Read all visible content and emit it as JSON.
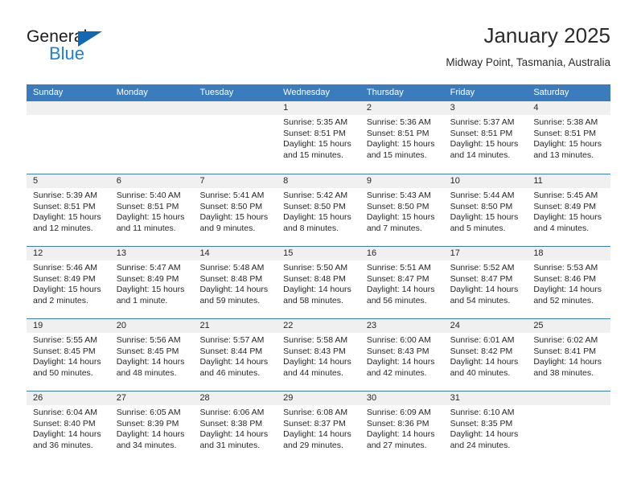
{
  "brand": {
    "name_part1": "General",
    "name_part2": "Blue",
    "triangle_color": "#1268b3",
    "blue_color": "#1f7fd0"
  },
  "header": {
    "title": "January 2025",
    "subtitle": "Midway Point, Tasmania, Australia"
  },
  "theme": {
    "header_row_bg": "#3a7cbd",
    "day_number_strip_bg": "#f0f0f0",
    "cell_bg": "#ffffff",
    "text_color": "#262626"
  },
  "calendar": {
    "weekday_headers": [
      "Sunday",
      "Monday",
      "Tuesday",
      "Wednesday",
      "Thursday",
      "Friday",
      "Saturday"
    ],
    "weeks": [
      [
        {
          "day": "",
          "empty": true
        },
        {
          "day": "",
          "empty": true
        },
        {
          "day": "",
          "empty": true
        },
        {
          "day": "1",
          "sunrise": "Sunrise: 5:35 AM",
          "sunset": "Sunset: 8:51 PM",
          "daylight1": "Daylight: 15 hours",
          "daylight2": "and 15 minutes."
        },
        {
          "day": "2",
          "sunrise": "Sunrise: 5:36 AM",
          "sunset": "Sunset: 8:51 PM",
          "daylight1": "Daylight: 15 hours",
          "daylight2": "and 15 minutes."
        },
        {
          "day": "3",
          "sunrise": "Sunrise: 5:37 AM",
          "sunset": "Sunset: 8:51 PM",
          "daylight1": "Daylight: 15 hours",
          "daylight2": "and 14 minutes."
        },
        {
          "day": "4",
          "sunrise": "Sunrise: 5:38 AM",
          "sunset": "Sunset: 8:51 PM",
          "daylight1": "Daylight: 15 hours",
          "daylight2": "and 13 minutes."
        }
      ],
      [
        {
          "day": "5",
          "sunrise": "Sunrise: 5:39 AM",
          "sunset": "Sunset: 8:51 PM",
          "daylight1": "Daylight: 15 hours",
          "daylight2": "and 12 minutes."
        },
        {
          "day": "6",
          "sunrise": "Sunrise: 5:40 AM",
          "sunset": "Sunset: 8:51 PM",
          "daylight1": "Daylight: 15 hours",
          "daylight2": "and 11 minutes."
        },
        {
          "day": "7",
          "sunrise": "Sunrise: 5:41 AM",
          "sunset": "Sunset: 8:50 PM",
          "daylight1": "Daylight: 15 hours",
          "daylight2": "and 9 minutes."
        },
        {
          "day": "8",
          "sunrise": "Sunrise: 5:42 AM",
          "sunset": "Sunset: 8:50 PM",
          "daylight1": "Daylight: 15 hours",
          "daylight2": "and 8 minutes."
        },
        {
          "day": "9",
          "sunrise": "Sunrise: 5:43 AM",
          "sunset": "Sunset: 8:50 PM",
          "daylight1": "Daylight: 15 hours",
          "daylight2": "and 7 minutes."
        },
        {
          "day": "10",
          "sunrise": "Sunrise: 5:44 AM",
          "sunset": "Sunset: 8:50 PM",
          "daylight1": "Daylight: 15 hours",
          "daylight2": "and 5 minutes."
        },
        {
          "day": "11",
          "sunrise": "Sunrise: 5:45 AM",
          "sunset": "Sunset: 8:49 PM",
          "daylight1": "Daylight: 15 hours",
          "daylight2": "and 4 minutes."
        }
      ],
      [
        {
          "day": "12",
          "sunrise": "Sunrise: 5:46 AM",
          "sunset": "Sunset: 8:49 PM",
          "daylight1": "Daylight: 15 hours",
          "daylight2": "and 2 minutes."
        },
        {
          "day": "13",
          "sunrise": "Sunrise: 5:47 AM",
          "sunset": "Sunset: 8:49 PM",
          "daylight1": "Daylight: 15 hours",
          "daylight2": "and 1 minute."
        },
        {
          "day": "14",
          "sunrise": "Sunrise: 5:48 AM",
          "sunset": "Sunset: 8:48 PM",
          "daylight1": "Daylight: 14 hours",
          "daylight2": "and 59 minutes."
        },
        {
          "day": "15",
          "sunrise": "Sunrise: 5:50 AM",
          "sunset": "Sunset: 8:48 PM",
          "daylight1": "Daylight: 14 hours",
          "daylight2": "and 58 minutes."
        },
        {
          "day": "16",
          "sunrise": "Sunrise: 5:51 AM",
          "sunset": "Sunset: 8:47 PM",
          "daylight1": "Daylight: 14 hours",
          "daylight2": "and 56 minutes."
        },
        {
          "day": "17",
          "sunrise": "Sunrise: 5:52 AM",
          "sunset": "Sunset: 8:47 PM",
          "daylight1": "Daylight: 14 hours",
          "daylight2": "and 54 minutes."
        },
        {
          "day": "18",
          "sunrise": "Sunrise: 5:53 AM",
          "sunset": "Sunset: 8:46 PM",
          "daylight1": "Daylight: 14 hours",
          "daylight2": "and 52 minutes."
        }
      ],
      [
        {
          "day": "19",
          "sunrise": "Sunrise: 5:55 AM",
          "sunset": "Sunset: 8:45 PM",
          "daylight1": "Daylight: 14 hours",
          "daylight2": "and 50 minutes."
        },
        {
          "day": "20",
          "sunrise": "Sunrise: 5:56 AM",
          "sunset": "Sunset: 8:45 PM",
          "daylight1": "Daylight: 14 hours",
          "daylight2": "and 48 minutes."
        },
        {
          "day": "21",
          "sunrise": "Sunrise: 5:57 AM",
          "sunset": "Sunset: 8:44 PM",
          "daylight1": "Daylight: 14 hours",
          "daylight2": "and 46 minutes."
        },
        {
          "day": "22",
          "sunrise": "Sunrise: 5:58 AM",
          "sunset": "Sunset: 8:43 PM",
          "daylight1": "Daylight: 14 hours",
          "daylight2": "and 44 minutes."
        },
        {
          "day": "23",
          "sunrise": "Sunrise: 6:00 AM",
          "sunset": "Sunset: 8:43 PM",
          "daylight1": "Daylight: 14 hours",
          "daylight2": "and 42 minutes."
        },
        {
          "day": "24",
          "sunrise": "Sunrise: 6:01 AM",
          "sunset": "Sunset: 8:42 PM",
          "daylight1": "Daylight: 14 hours",
          "daylight2": "and 40 minutes."
        },
        {
          "day": "25",
          "sunrise": "Sunrise: 6:02 AM",
          "sunset": "Sunset: 8:41 PM",
          "daylight1": "Daylight: 14 hours",
          "daylight2": "and 38 minutes."
        }
      ],
      [
        {
          "day": "26",
          "sunrise": "Sunrise: 6:04 AM",
          "sunset": "Sunset: 8:40 PM",
          "daylight1": "Daylight: 14 hours",
          "daylight2": "and 36 minutes."
        },
        {
          "day": "27",
          "sunrise": "Sunrise: 6:05 AM",
          "sunset": "Sunset: 8:39 PM",
          "daylight1": "Daylight: 14 hours",
          "daylight2": "and 34 minutes."
        },
        {
          "day": "28",
          "sunrise": "Sunrise: 6:06 AM",
          "sunset": "Sunset: 8:38 PM",
          "daylight1": "Daylight: 14 hours",
          "daylight2": "and 31 minutes."
        },
        {
          "day": "29",
          "sunrise": "Sunrise: 6:08 AM",
          "sunset": "Sunset: 8:37 PM",
          "daylight1": "Daylight: 14 hours",
          "daylight2": "and 29 minutes."
        },
        {
          "day": "30",
          "sunrise": "Sunrise: 6:09 AM",
          "sunset": "Sunset: 8:36 PM",
          "daylight1": "Daylight: 14 hours",
          "daylight2": "and 27 minutes."
        },
        {
          "day": "31",
          "sunrise": "Sunrise: 6:10 AM",
          "sunset": "Sunset: 8:35 PM",
          "daylight1": "Daylight: 14 hours",
          "daylight2": "and 24 minutes."
        },
        {
          "day": "",
          "empty": true
        }
      ]
    ]
  }
}
